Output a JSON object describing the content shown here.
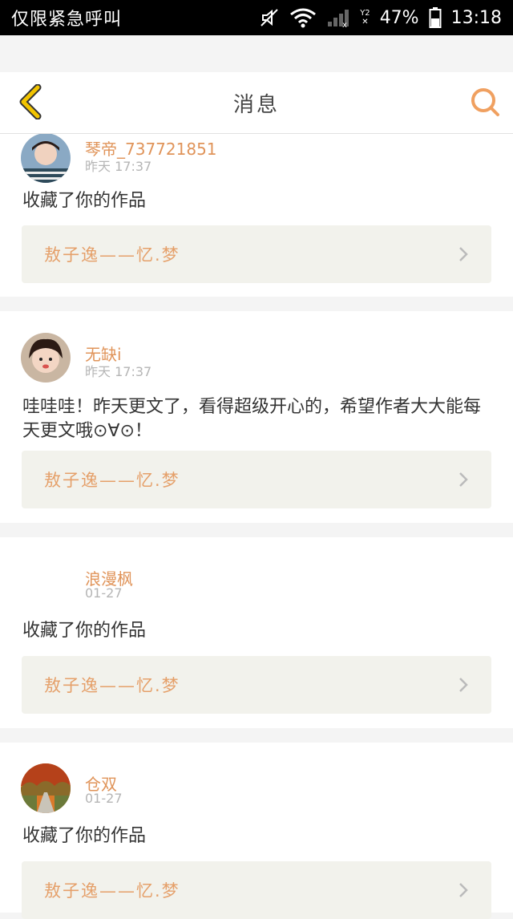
{
  "status_bar": {
    "carrier": "仅限紧急呼叫",
    "battery": "47%",
    "time": "13:18",
    "signal_label": "Y2"
  },
  "nav": {
    "title": "消息"
  },
  "messages": [
    {
      "user": "琴帝_737721851",
      "time": "昨天 17:37",
      "text": "收藏了你的作品",
      "work": "敖子逸——忆.梦"
    },
    {
      "user": "无缺i",
      "time": "昨天 17:37",
      "text": "哇哇哇！昨天更文了，看得超级开心的，希望作者大大能每天更文哦⊙∀⊙！",
      "work": "敖子逸——忆.梦"
    },
    {
      "user": "浪漫枫",
      "time": "01-27",
      "text": "收藏了你的作品",
      "work": "敖子逸——忆.梦"
    },
    {
      "user": "仓双",
      "time": "01-27",
      "text": "收藏了你的作品",
      "work": "敖子逸——忆.梦"
    }
  ],
  "colors": {
    "accent": "#e0945a",
    "back_icon": "#f2c400",
    "search_icon": "#f0a060",
    "link_bg": "#f2f2ec"
  }
}
